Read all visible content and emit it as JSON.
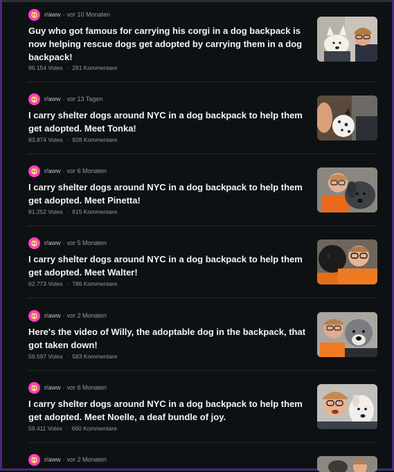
{
  "posts": [
    {
      "subreddit": "r/aww",
      "age": "vor 10 Monaten",
      "title": "Guy who got famous for carrying his corgi in a dog backpack is now helping rescue dogs get adopted by carrying them in a dog backpack!",
      "votes": "96.154 Votes",
      "comments": "281 Kommentare",
      "thumb_icon": "photo-corgi-backpack"
    },
    {
      "subreddit": "r/aww",
      "age": "vor 13 Tagen",
      "title": "I carry shelter dogs around NYC in a dog backpack to help them get adopted. Meet Tonka!",
      "votes": "83.874 Votes",
      "comments": "928 Kommentare",
      "thumb_icon": "photo-dalmatian"
    },
    {
      "subreddit": "r/aww",
      "age": "vor 6 Monaten",
      "title": "I carry shelter dogs around NYC in a dog backpack to help them get adopted. Meet Pinetta!",
      "votes": "81.252 Votes",
      "comments": "815 Kommentare",
      "thumb_icon": "photo-grey-dog"
    },
    {
      "subreddit": "r/aww",
      "age": "vor 5 Monaten",
      "title": "I carry shelter dogs around NYC in a dog backpack to help them get adopted. Meet Walter!",
      "votes": "62.773 Votes",
      "comments": "786 Kommentare",
      "thumb_icon": "photo-black-dog"
    },
    {
      "subreddit": "r/aww",
      "age": "vor 2 Monaten",
      "title": "Here's the video of Willy, the adoptable dog in the backpack, that got taken down!",
      "votes": "59.597 Votes",
      "comments": "583 Kommentare",
      "thumb_icon": "photo-willy"
    },
    {
      "subreddit": "r/aww",
      "age": "vor 6 Monaten",
      "title": "I carry shelter dogs around NYC in a dog backpack to help them get adopted. Meet Noelle, a deaf bundle of joy.",
      "votes": "59.411 Votes",
      "comments": "660 Kommentare",
      "thumb_icon": "photo-noelle"
    },
    {
      "subreddit": "r/aww",
      "age": "vor 2 Monaten",
      "title": "",
      "votes": "",
      "comments": "",
      "thumb_icon": "photo-partial"
    }
  ],
  "colors": {
    "background": "#0e1113",
    "subreddit_icon": "#ff3fc1",
    "meta_text": "#8e9aa3",
    "title_text": "#f2f4f5",
    "frame": "#4a2a7a"
  },
  "separator": "·"
}
